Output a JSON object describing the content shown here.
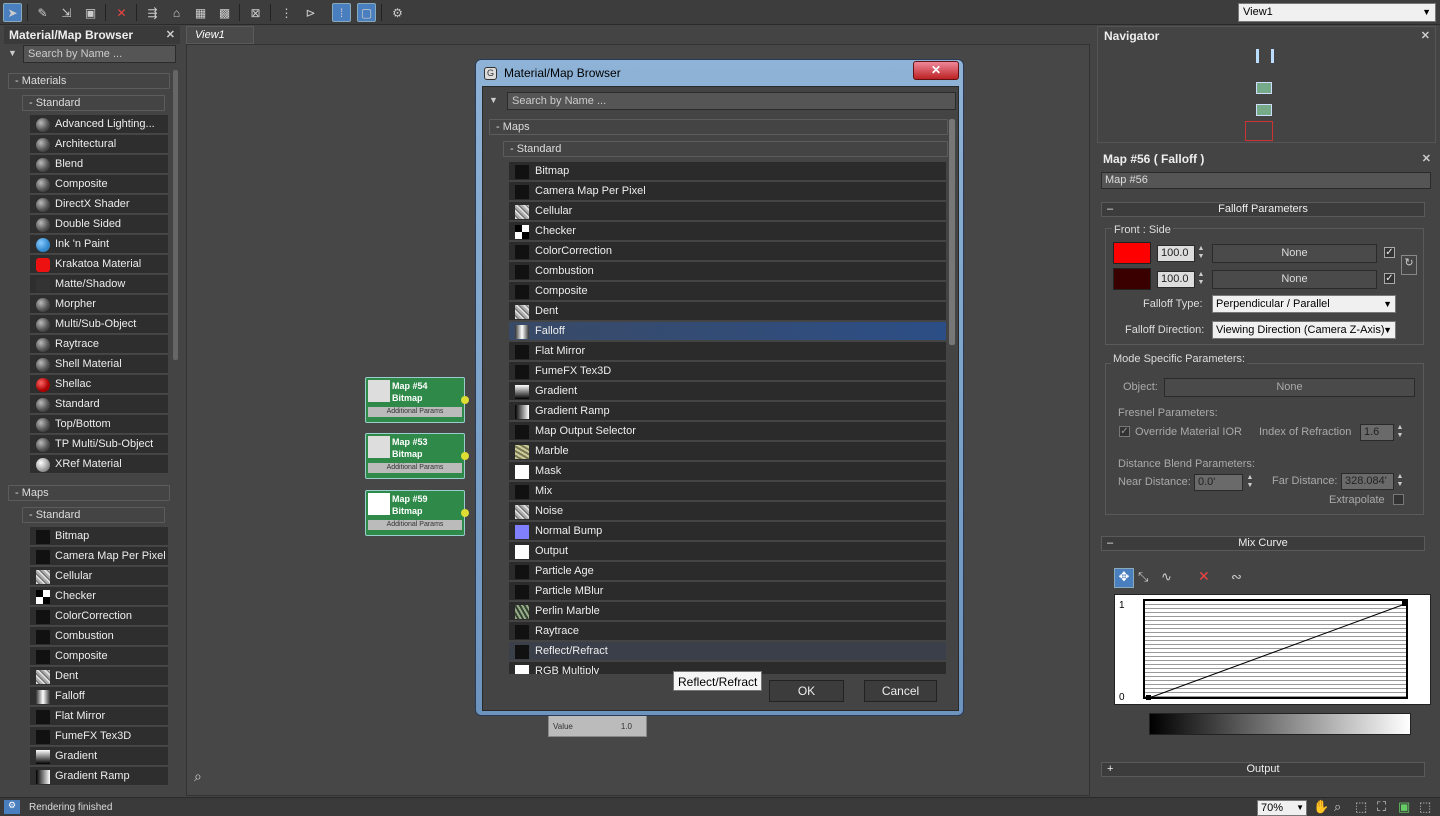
{
  "toolbar": {
    "view_dropdown": "View1"
  },
  "left_panel": {
    "title": "Material/Map Browser",
    "search_placeholder": "Search by Name ...",
    "materials_group": "- Materials",
    "standard_group": "- Standard",
    "materials": [
      {
        "label": "Advanced Lighting...",
        "icon": "ball"
      },
      {
        "label": "Architectural",
        "icon": "ball"
      },
      {
        "label": "Blend",
        "icon": "ball"
      },
      {
        "label": "Composite",
        "icon": "ball"
      },
      {
        "label": "DirectX Shader",
        "icon": "ball"
      },
      {
        "label": "Double Sided",
        "icon": "ball"
      },
      {
        "label": "Ink 'n Paint",
        "icon": "blue-ball"
      },
      {
        "label": "Krakatoa Material",
        "icon": "red-square"
      },
      {
        "label": "Matte/Shadow",
        "icon": "dark"
      },
      {
        "label": "Morpher",
        "icon": "ball"
      },
      {
        "label": "Multi/Sub-Object",
        "icon": "ball"
      },
      {
        "label": "Raytrace",
        "icon": "ball"
      },
      {
        "label": "Shell Material",
        "icon": "ball"
      },
      {
        "label": "Shellac",
        "icon": "red-ball"
      },
      {
        "label": "Standard",
        "icon": "ball"
      },
      {
        "label": "Top/Bottom",
        "icon": "ball"
      },
      {
        "label": "TP Multi/Sub-Object",
        "icon": "ball"
      },
      {
        "label": "XRef Material",
        "icon": "white-ball"
      }
    ],
    "maps_group": "- Maps",
    "maps_standard_group": "- Standard",
    "maps": [
      {
        "label": "Bitmap",
        "icon": "blk"
      },
      {
        "label": "Camera Map Per Pixel",
        "icon": "blk"
      },
      {
        "label": "Cellular",
        "icon": "noi"
      },
      {
        "label": "Checker",
        "icon": "chk"
      },
      {
        "label": "ColorCorrection",
        "icon": "blk"
      },
      {
        "label": "Combustion",
        "icon": "blk"
      },
      {
        "label": "Composite",
        "icon": "blk"
      },
      {
        "label": "Dent",
        "icon": "noi"
      },
      {
        "label": "Falloff",
        "icon": "fal"
      },
      {
        "label": "Flat Mirror",
        "icon": "blk"
      },
      {
        "label": "FumeFX Tex3D",
        "icon": "blk"
      },
      {
        "label": "Gradient",
        "icon": "grd"
      },
      {
        "label": "Gradient Ramp",
        "icon": "grdh"
      }
    ]
  },
  "view": {
    "tab": "View1",
    "nodes": [
      {
        "id": "Map #54",
        "type": "Bitmap",
        "params": "Additional Params"
      },
      {
        "id": "Map #53",
        "type": "Bitmap",
        "params": "Additional Params"
      },
      {
        "id": "Map #59",
        "type": "Bitmap",
        "params": "Additional Params"
      }
    ],
    "partial_node": {
      "label": "Value",
      "value": "1.0"
    }
  },
  "dialog": {
    "title": "Material/Map Browser",
    "close": "✕",
    "search_placeholder": "Search by Name ...",
    "maps_group": "- Maps",
    "standard_group": "- Standard",
    "items": [
      {
        "label": "Bitmap",
        "icon": "blk"
      },
      {
        "label": "Camera Map Per Pixel",
        "icon": "blk"
      },
      {
        "label": "Cellular",
        "icon": "noi"
      },
      {
        "label": "Checker",
        "icon": "chk"
      },
      {
        "label": "ColorCorrection",
        "icon": "blk"
      },
      {
        "label": "Combustion",
        "icon": "blk"
      },
      {
        "label": "Composite",
        "icon": "blk"
      },
      {
        "label": "Dent",
        "icon": "noi"
      },
      {
        "label": "Falloff",
        "icon": "fal",
        "state": "selected"
      },
      {
        "label": "Flat Mirror",
        "icon": "blk"
      },
      {
        "label": "FumeFX Tex3D",
        "icon": "blk"
      },
      {
        "label": "Gradient",
        "icon": "grd"
      },
      {
        "label": "Gradient Ramp",
        "icon": "grdh"
      },
      {
        "label": "Map Output Selector",
        "icon": "blk"
      },
      {
        "label": "Marble",
        "icon": "mar"
      },
      {
        "label": "Mask",
        "icon": "wht"
      },
      {
        "label": "Mix",
        "icon": "blk"
      },
      {
        "label": "Noise",
        "icon": "noi"
      },
      {
        "label": "Normal Bump",
        "icon": "nbm"
      },
      {
        "label": "Output",
        "icon": "wht"
      },
      {
        "label": "Particle Age",
        "icon": "blk"
      },
      {
        "label": "Particle MBlur",
        "icon": "blk"
      },
      {
        "label": "Perlin Marble",
        "icon": "prl"
      },
      {
        "label": "Raytrace",
        "icon": "blk"
      },
      {
        "label": "Reflect/Refract",
        "icon": "blk",
        "state": "hover"
      },
      {
        "label": "RGB Multiply",
        "icon": "wht"
      }
    ],
    "tooltip": "Reflect/Refract",
    "ok": "OK",
    "cancel": "Cancel"
  },
  "navigator": {
    "title": "Navigator"
  },
  "properties": {
    "title": "Map #56  ( Falloff )",
    "name_field": "Map #56",
    "falloff_params": "Falloff Parameters",
    "front_side": "Front : Side",
    "front_value": "100.0",
    "side_value": "100.0",
    "none": "None",
    "front_color": "#ff0000",
    "side_color": "#3a0000",
    "falloff_type_label": "Falloff Type:",
    "falloff_type": "Perpendicular / Parallel",
    "falloff_direction_label": "Falloff Direction:",
    "falloff_direction": "Viewing Direction (Camera Z-Axis)",
    "mode_specific": "Mode Specific Parameters:",
    "object_label": "Object:",
    "object_value": "None",
    "fresnel_label": "Fresnel Parameters:",
    "override_ior": "Override Material IOR",
    "ior_label": "Index of Refraction",
    "ior_value": "1.6",
    "distance_blend": "Distance Blend Parameters:",
    "near_label": "Near Distance:",
    "near_value": "0.0'",
    "far_label": "Far Distance:",
    "far_value": "328.084'",
    "extrapolate": "Extrapolate",
    "mix_curve": "Mix Curve",
    "curve_y_top": "1",
    "curve_y_bottom": "0",
    "output": "Output"
  },
  "status": {
    "text": "Rendering finished",
    "zoom": "70%"
  }
}
